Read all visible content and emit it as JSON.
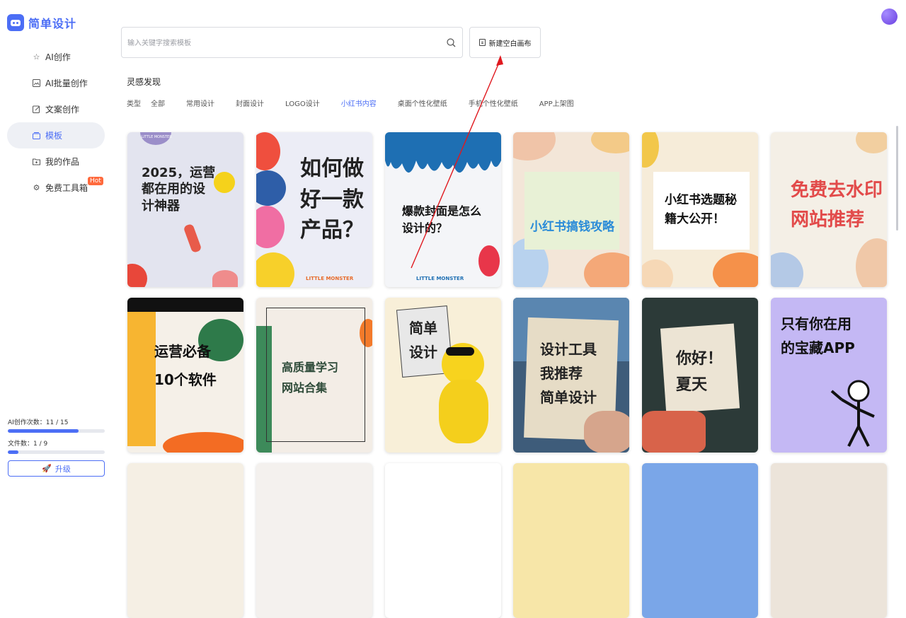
{
  "app": {
    "name": "简单设计"
  },
  "sidebar": {
    "items": [
      {
        "label": "AI创作",
        "icon": "star-icon"
      },
      {
        "label": "AI批量创作",
        "icon": "image-icon"
      },
      {
        "label": "文案创作",
        "icon": "edit-icon"
      },
      {
        "label": "模板",
        "icon": "template-icon",
        "active": true
      },
      {
        "label": "我的作品",
        "icon": "folder-icon"
      },
      {
        "label": "免费工具箱",
        "icon": "gear-icon",
        "badge": "Hot"
      }
    ],
    "quota": {
      "ai_label": "AI创作次数：11 / 15",
      "ai_used": 11,
      "ai_total": 15,
      "file_label": "文件数：1 / 9",
      "file_used": 1,
      "file_total": 9
    },
    "upgrade_label": "升级"
  },
  "search": {
    "placeholder": "输入关键字搜索模板"
  },
  "new_canvas_label": "新建空白画布",
  "section_title": "灵感发现",
  "filters": {
    "label": "类型",
    "options": [
      "全部",
      "常用设计",
      "封面设计",
      "LOGO设计",
      "小红书内容",
      "桌面个性化壁纸",
      "手机个性化壁纸",
      "APP上架图"
    ],
    "selected": "小红书内容"
  },
  "templates": [
    {
      "text": "2025，运营都在用的设计神器",
      "line1": "2025，运营",
      "line2": "都在用的设",
      "line3": "计神器",
      "brand": "LITTLE MONSTER"
    },
    {
      "line1": "如何做",
      "line2": "好一款",
      "line3": "产品？",
      "brand": "LITTLE MONSTER"
    },
    {
      "line1": "爆款封面是怎么",
      "line2": "设计的？",
      "brand": "LITTLE MONSTER"
    },
    {
      "line1": "小红书搞钱攻略"
    },
    {
      "line1": "小红书选题秘",
      "line2": "籍大公开！"
    },
    {
      "line1": "免费去水印",
      "line2": "网站推荐"
    },
    {
      "line1": "运营必备",
      "line2": "10个软件"
    },
    {
      "line1": "高质量学习",
      "line2": "网站合集"
    },
    {
      "line1": "简单",
      "line2": "设计"
    },
    {
      "line1": "设计工具",
      "line2": "我推荐",
      "line3": "简单设计"
    },
    {
      "line1": "你好！",
      "line2": "夏天"
    },
    {
      "line1": "只有你在用",
      "line2": "的宝藏APP"
    }
  ],
  "colors": {
    "accent": "#4c6ef5",
    "hot": "#ff6a3d",
    "annotation": "#e0191f"
  }
}
